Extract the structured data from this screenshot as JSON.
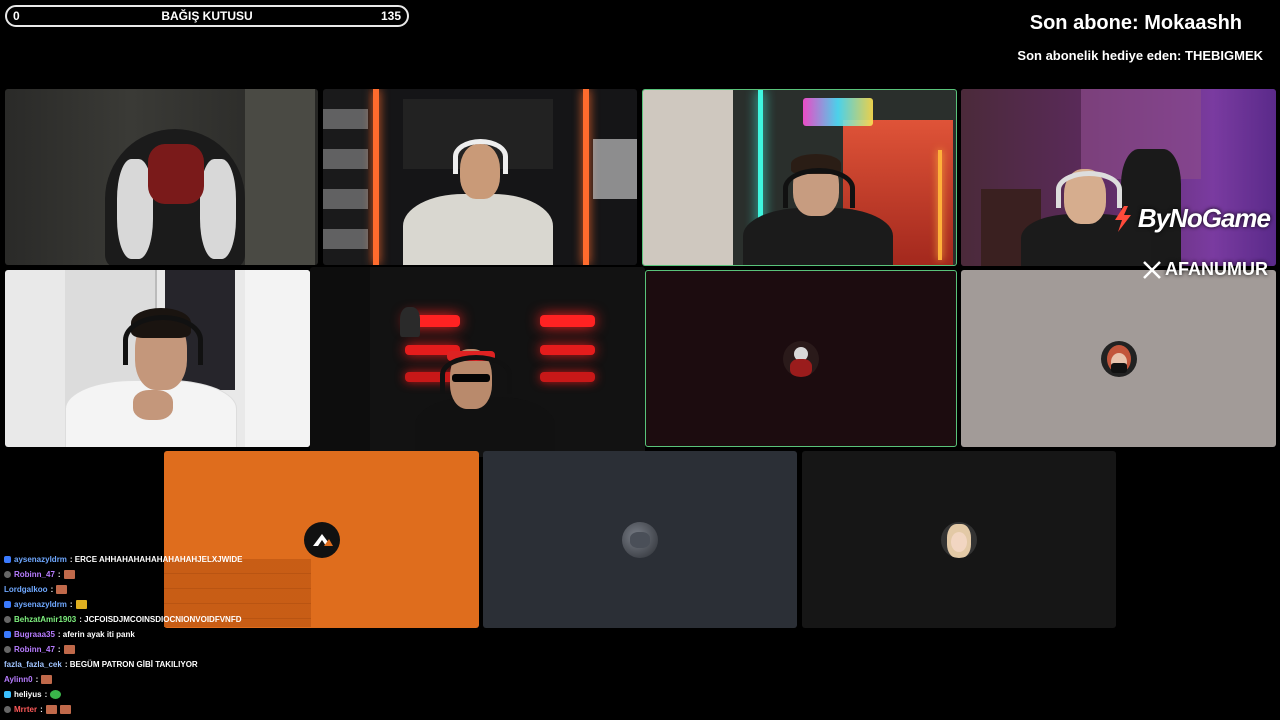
{
  "donation": {
    "left_value": "0",
    "title": "BAĞIŞ KUTUSU",
    "right_value": "135"
  },
  "subs": {
    "last_sub": "Son abone: Mokaashh",
    "last_gift": "Son abonelik hediye eden: THEBIGMEK"
  },
  "overlay": {
    "sponsor": "ByNoGame",
    "x_handle": "AFANUMUR"
  },
  "tiles": [
    {
      "id": "cam-empty-chair",
      "type": "camera"
    },
    {
      "id": "cam-white-tshirt",
      "type": "camera"
    },
    {
      "id": "cam-neon-room",
      "type": "camera",
      "active": true
    },
    {
      "id": "cam-purple-room",
      "type": "camera"
    },
    {
      "id": "cam-white-room",
      "type": "camera"
    },
    {
      "id": "cam-red-lights",
      "type": "camera"
    },
    {
      "id": "avatar-dark-red",
      "type": "avatar",
      "active": true
    },
    {
      "id": "avatar-gray",
      "type": "avatar"
    },
    {
      "id": "avatar-orange",
      "type": "avatar"
    },
    {
      "id": "avatar-slate",
      "type": "avatar"
    },
    {
      "id": "avatar-black",
      "type": "avatar"
    }
  ],
  "chat": [
    {
      "user": "aysenazyldrm",
      "message": ": ERCE AHHAHAHAHAHAHAHAHJELXJWIDE",
      "user_color": "#6fa8ff"
    },
    {
      "user": "Robinn_47",
      "message": ":",
      "user_color": "#b77cff",
      "emote": true
    },
    {
      "user": "Lordgalkoo",
      "message": ":",
      "user_color": "#6fa8ff",
      "emote": true
    },
    {
      "user": "aysenazyldrm",
      "message": ":",
      "user_color": "#6fa8ff",
      "emote": true
    },
    {
      "user": "BehzatAmir1903",
      "message": ": JCFOISDJMCOINSDIOCNIONVOIDFVNFD",
      "user_color": "#7ef07e"
    },
    {
      "user": "Bugraaa35",
      "message": ": aferin ayak iti pank",
      "user_color": "#b77cff"
    },
    {
      "user": "Robinn_47",
      "message": ":",
      "user_color": "#b77cff",
      "emote": true
    },
    {
      "user": "fazla_fazla_cek",
      "message": ": BEGÜM PATRON GİBİ TAKILIYOR",
      "user_color": "#a0c4ff"
    },
    {
      "user": "Aylinn0",
      "message": ":",
      "user_color": "#b77cff",
      "emote": true
    },
    {
      "user": "heliyus",
      "message": ":",
      "user_color": "#ffffff",
      "emote": true
    },
    {
      "user": "Mrrter",
      "message": ":",
      "user_color": "#ff5a5a",
      "emote": true
    }
  ],
  "colors": {
    "active_border": "#59c37a",
    "orange_tile": "#df6d1d",
    "slate_tile": "#2b2f36"
  }
}
